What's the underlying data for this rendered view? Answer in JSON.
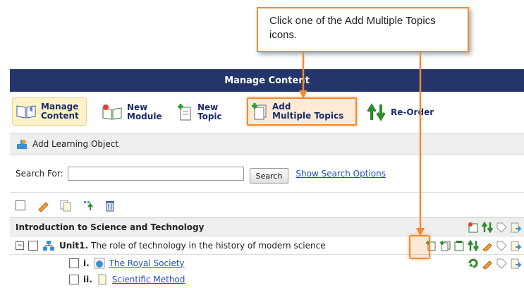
{
  "callout": {
    "text": "Click one of the Add Multiple Topics icons."
  },
  "titlebar": {
    "title": "Manage Content"
  },
  "toolbar": {
    "manage": [
      "Manage",
      "Content"
    ],
    "new_module": [
      "New",
      "Module"
    ],
    "new_topic": [
      "New",
      "Topic"
    ],
    "add_multiple": [
      "Add",
      "Multiple Topics"
    ],
    "reorder": "Re-Order"
  },
  "add_learning_object": "Add Learning Object",
  "search": {
    "label": "Search For:",
    "value": "",
    "button": "Search",
    "options_link": "Show Search Options"
  },
  "course": {
    "title": "Introduction to Science and Technology"
  },
  "unit": {
    "number": "Unit1.",
    "title": "The role of technology in the history of modern science"
  },
  "topics": [
    {
      "number": "i.",
      "title": "The Royal Society"
    },
    {
      "number": "ii.",
      "title": "Scientific Method"
    }
  ],
  "colors": {
    "accent": "#f28a2e",
    "titlebar": "#23356b",
    "link": "#1f4fbf"
  }
}
